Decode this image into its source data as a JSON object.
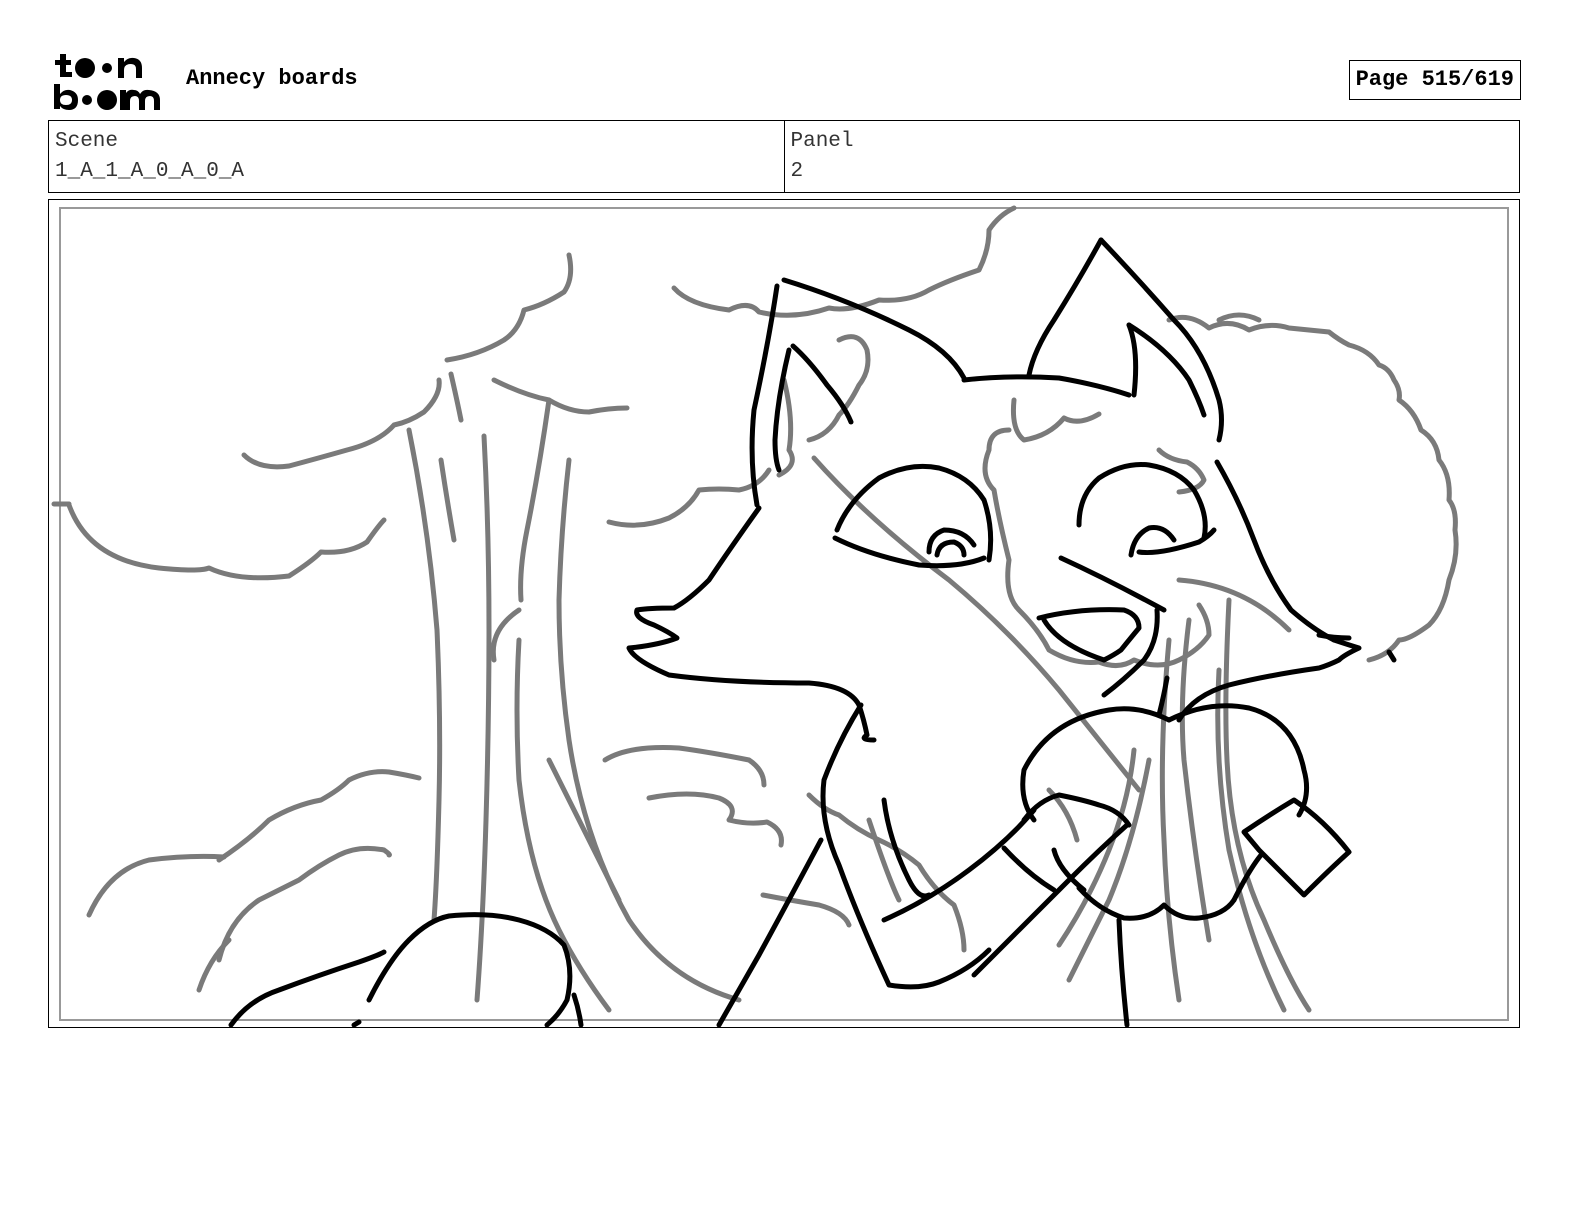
{
  "header": {
    "logo_top": "toon",
    "logo_bottom": "boom",
    "title": "Annecy boards",
    "page_label": "Page 515/619"
  },
  "info": {
    "scene_label": "Scene",
    "scene_value": "1_A_1_A_0_A_0_A",
    "panel_label": "Panel",
    "panel_value": "2"
  },
  "colors": {
    "ink": "#000000",
    "rough_sketch": "#7a7a7a"
  }
}
